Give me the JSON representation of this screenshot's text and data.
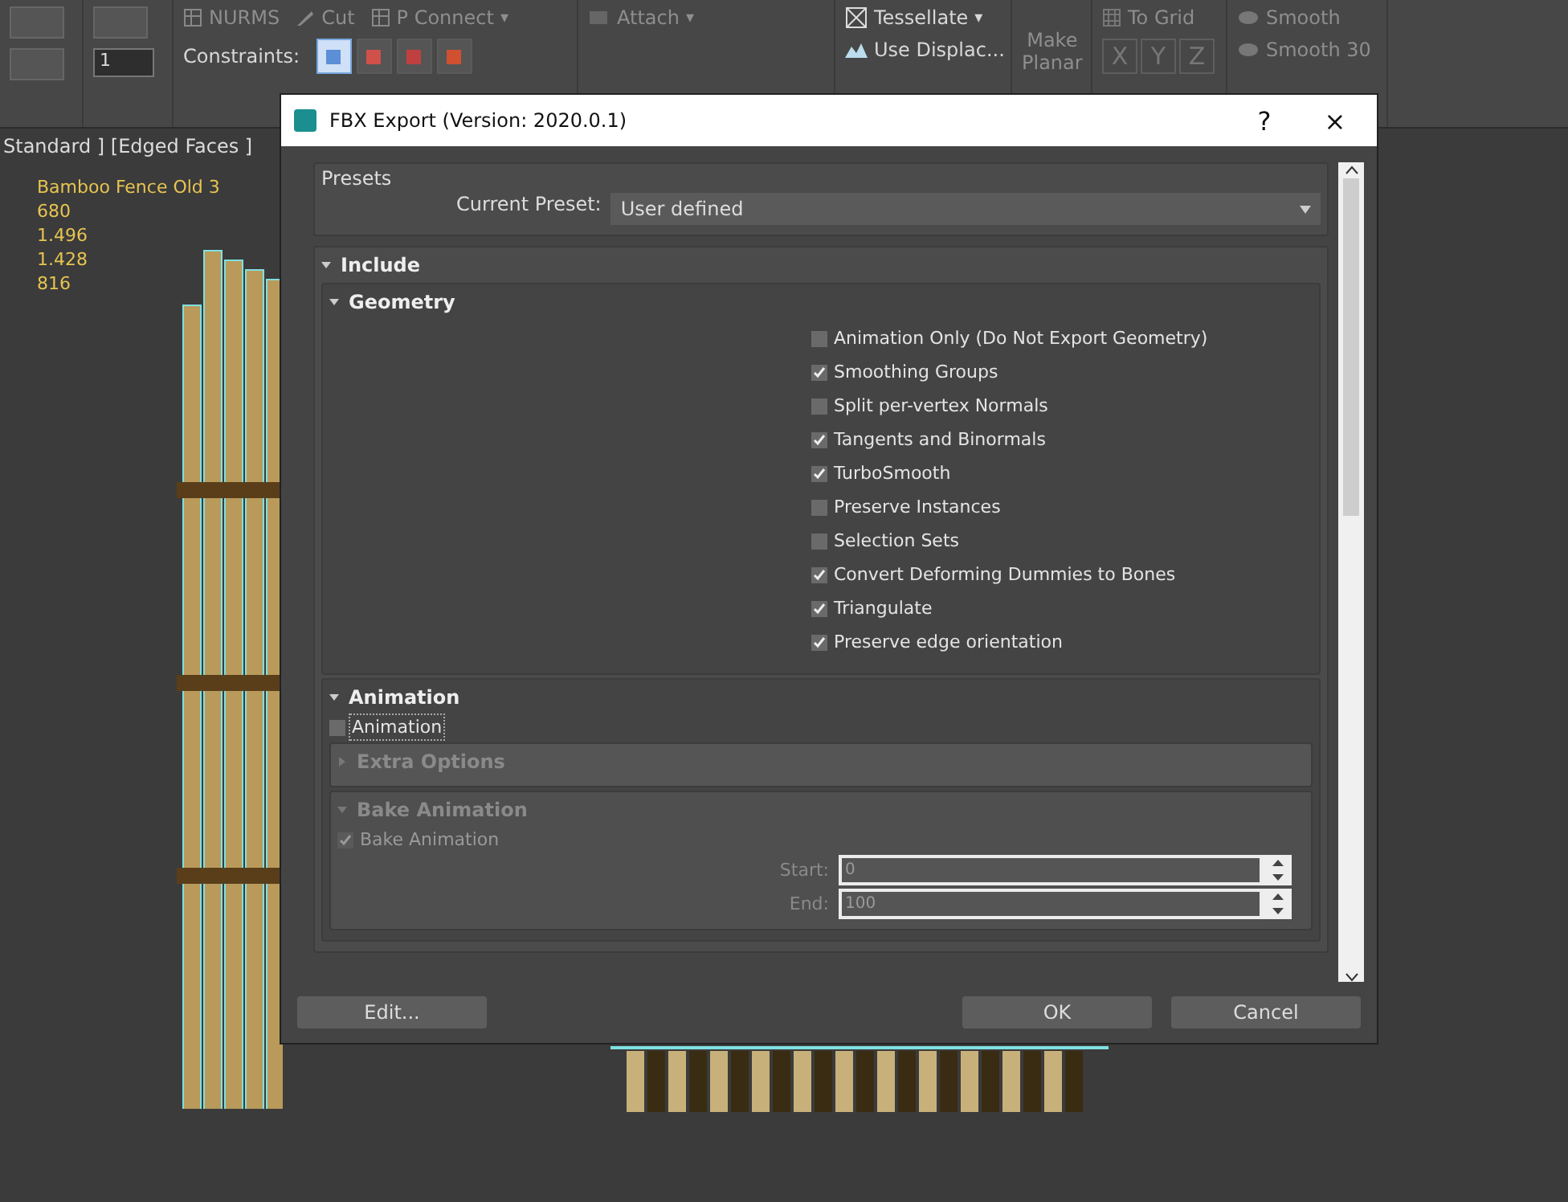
{
  "ribbon": {
    "row1": [
      {
        "kind": "grid",
        "label": "NURMS"
      },
      {
        "kind": "knife",
        "label": "Cut"
      },
      {
        "kind": "grid",
        "label": "P Connect",
        "caret": "▾"
      }
    ],
    "constraints_label": "Constraints:",
    "constraints": [
      {
        "selected": true
      },
      {
        "selected": false
      },
      {
        "selected": false
      },
      {
        "selected": false
      }
    ],
    "spinner": "1",
    "attach": "Attach",
    "attach_caret": "▾",
    "tessellate": "Tessellate",
    "tessellate_caret": "▾",
    "use_displace": "Use Displac...",
    "make_planar": "Make Planar",
    "to_grid": "To Grid",
    "axes": [
      "X",
      "Y",
      "Z"
    ],
    "smooth": "Smooth",
    "smooth30": "Smooth 30"
  },
  "viewport": {
    "label": "Standard ] [Edged Faces ]",
    "stats": [
      "Bamboo Fence Old 3",
      "680",
      "1.496",
      "1.428",
      "816"
    ]
  },
  "dialog": {
    "title": "FBX Export (Version: 2020.0.1)",
    "help": "?",
    "close": "×",
    "presets": {
      "title": "Presets",
      "label": "Current Preset:",
      "value": "User defined"
    },
    "include": {
      "title": "Include",
      "expanded": true
    },
    "geometry": {
      "title": "Geometry",
      "expanded": true,
      "options": [
        {
          "label": "Animation Only (Do Not Export Geometry)",
          "checked": false
        },
        {
          "label": "Smoothing Groups",
          "checked": true
        },
        {
          "label": "Split per-vertex Normals",
          "checked": false
        },
        {
          "label": "Tangents and Binormals",
          "checked": true
        },
        {
          "label": "TurboSmooth",
          "checked": true
        },
        {
          "label": "Preserve Instances",
          "checked": false
        },
        {
          "label": "Selection Sets",
          "checked": false
        },
        {
          "label": "Convert Deforming Dummies to Bones",
          "checked": true
        },
        {
          "label": "Triangulate",
          "checked": true
        },
        {
          "label": "Preserve edge orientation",
          "checked": true
        }
      ]
    },
    "animation": {
      "title": "Animation",
      "expanded": true,
      "checkbox": {
        "label": "Animation",
        "checked": false
      },
      "extra": {
        "title": "Extra Options",
        "expanded": false
      },
      "bake": {
        "title": "Bake Animation",
        "expanded": true,
        "disabled": true,
        "checkbox": {
          "label": "Bake Animation",
          "checked": true
        },
        "fields": [
          {
            "label": "Start:",
            "value": "0"
          },
          {
            "label": "End:",
            "value": "100"
          }
        ]
      }
    },
    "buttons": {
      "edit": "Edit...",
      "ok": "OK",
      "cancel": "Cancel"
    }
  }
}
